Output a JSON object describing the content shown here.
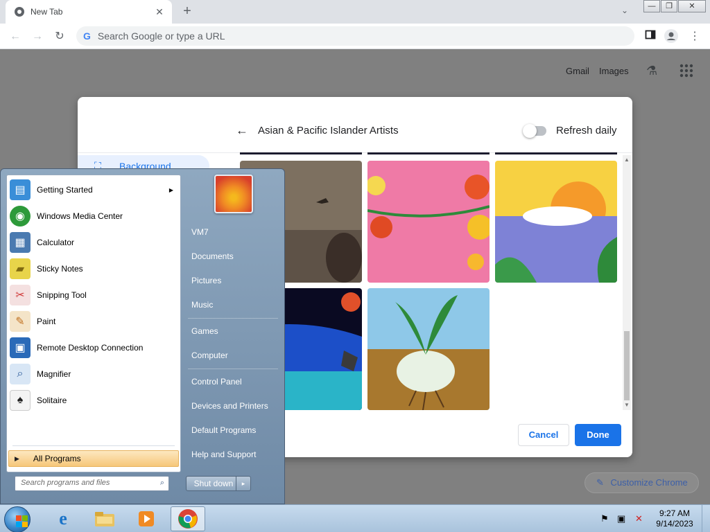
{
  "browser": {
    "tab_title": "New Tab",
    "tab_close": "✕",
    "new_tab": "+",
    "tab_search": "⌄",
    "window_controls": [
      "—",
      "❐",
      "✕"
    ],
    "omnibox_placeholder": "Search Google or type a URL",
    "omnibox_g": "G",
    "back": "←",
    "forward": "→",
    "reload": "↻",
    "menu": "⋮"
  },
  "ntp": {
    "gmail": "Gmail",
    "images": "Images",
    "labs_icon": "⚗",
    "apps_icon": "⋮⋮⋮",
    "customize": "Customize Chrome",
    "customize_icon": "✎"
  },
  "dialog": {
    "back_icon": "←",
    "title": "Asian & Pacific Islander Artists",
    "refresh_label": "Refresh daily",
    "sidebar_selected": "Background",
    "sidebar_icon": "⛶",
    "cancel": "Cancel",
    "done": "Done",
    "tiles": [
      {
        "name": "tile-1",
        "colors": [
          "#8a7a68",
          "#5b4a3c"
        ]
      },
      {
        "name": "tile-2",
        "colors": [
          "#f07aa8",
          "#e0518c"
        ]
      },
      {
        "name": "tile-3",
        "colors": [
          "#f7d142",
          "#7e82d6"
        ]
      },
      {
        "name": "tile-4",
        "colors": [
          "#0a0a1f",
          "#28a0c8"
        ]
      },
      {
        "name": "tile-5",
        "colors": [
          "#8ec8e8",
          "#b0823a"
        ]
      }
    ]
  },
  "start_menu": {
    "programs": [
      {
        "label": "Getting Started",
        "icon": "▤",
        "has_arrow": true,
        "color": "#3a8ed8"
      },
      {
        "label": "Windows Media Center",
        "icon": "◉",
        "has_arrow": false,
        "color": "#2d9a3a"
      },
      {
        "label": "Calculator",
        "icon": "▦",
        "has_arrow": false,
        "color": "#4a7ab0"
      },
      {
        "label": "Sticky Notes",
        "icon": "▰",
        "has_arrow": false,
        "color": "#e8d44a"
      },
      {
        "label": "Snipping Tool",
        "icon": "✂",
        "has_arrow": false,
        "color": "#d03a3a"
      },
      {
        "label": "Paint",
        "icon": "✎",
        "has_arrow": false,
        "color": "#e0a040"
      },
      {
        "label": "Remote Desktop Connection",
        "icon": "▣",
        "has_arrow": false,
        "color": "#2a6ab8"
      },
      {
        "label": "Magnifier",
        "icon": "⌕",
        "has_arrow": false,
        "color": "#5a8ac8"
      },
      {
        "label": "Solitaire",
        "icon": "♠",
        "has_arrow": false,
        "color": "#444"
      }
    ],
    "all_programs": "All Programs",
    "search_placeholder": "Search programs and files",
    "search_icon": "⌕",
    "right_items": [
      "VM7",
      "Documents",
      "Pictures",
      "Music",
      "Games",
      "Computer",
      "Control Panel",
      "Devices and Printers",
      "Default Programs",
      "Help and Support"
    ],
    "shutdown": "Shut down",
    "shutdown_arrow": "▸",
    "arrow": "▶"
  },
  "taskbar": {
    "apps": [
      {
        "name": "internet-explorer",
        "icon": "e",
        "color": "#1b74c8"
      },
      {
        "name": "file-explorer",
        "icon": "▬",
        "color": "#e0b040"
      },
      {
        "name": "media-player",
        "icon": "▶",
        "color": "#e07020"
      },
      {
        "name": "chrome",
        "icon": "◉",
        "color": "#db4437"
      }
    ],
    "tray": [
      "⚑",
      "▣",
      "✕"
    ],
    "time": "9:27 AM",
    "date": "9/14/2023"
  }
}
